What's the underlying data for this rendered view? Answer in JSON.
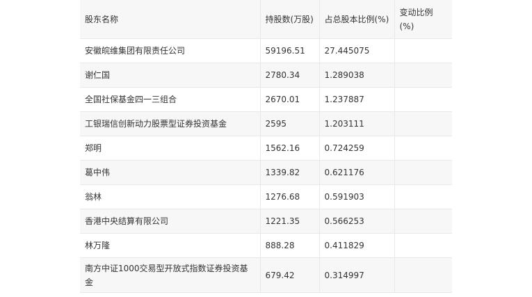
{
  "table": {
    "headers": [
      "股东名称",
      "持股数(万股)",
      "占总股本比例(%)",
      "变动比例(%)"
    ],
    "rows": [
      [
        "安徽皖维集团有限责任公司",
        "59196.51",
        "27.445075",
        ""
      ],
      [
        "谢仁国",
        "2780.34",
        "1.289038",
        ""
      ],
      [
        "全国社保基金四一三组合",
        "2670.01",
        "1.237887",
        ""
      ],
      [
        "工银瑞信创新动力股票型证券投资基金",
        "2595",
        "1.203111",
        ""
      ],
      [
        "郑明",
        "1562.16",
        "0.724259",
        ""
      ],
      [
        "葛中伟",
        "1339.82",
        "0.621176",
        ""
      ],
      [
        "翁林",
        "1276.68",
        "0.591903",
        ""
      ],
      [
        "香港中央结算有限公司",
        "1221.35",
        "0.566253",
        ""
      ],
      [
        "林万隆",
        "888.28",
        "0.411829",
        ""
      ],
      [
        "南方中证1000交易型开放式指数证券投资基金",
        "679.42",
        "0.314997",
        ""
      ]
    ]
  }
}
